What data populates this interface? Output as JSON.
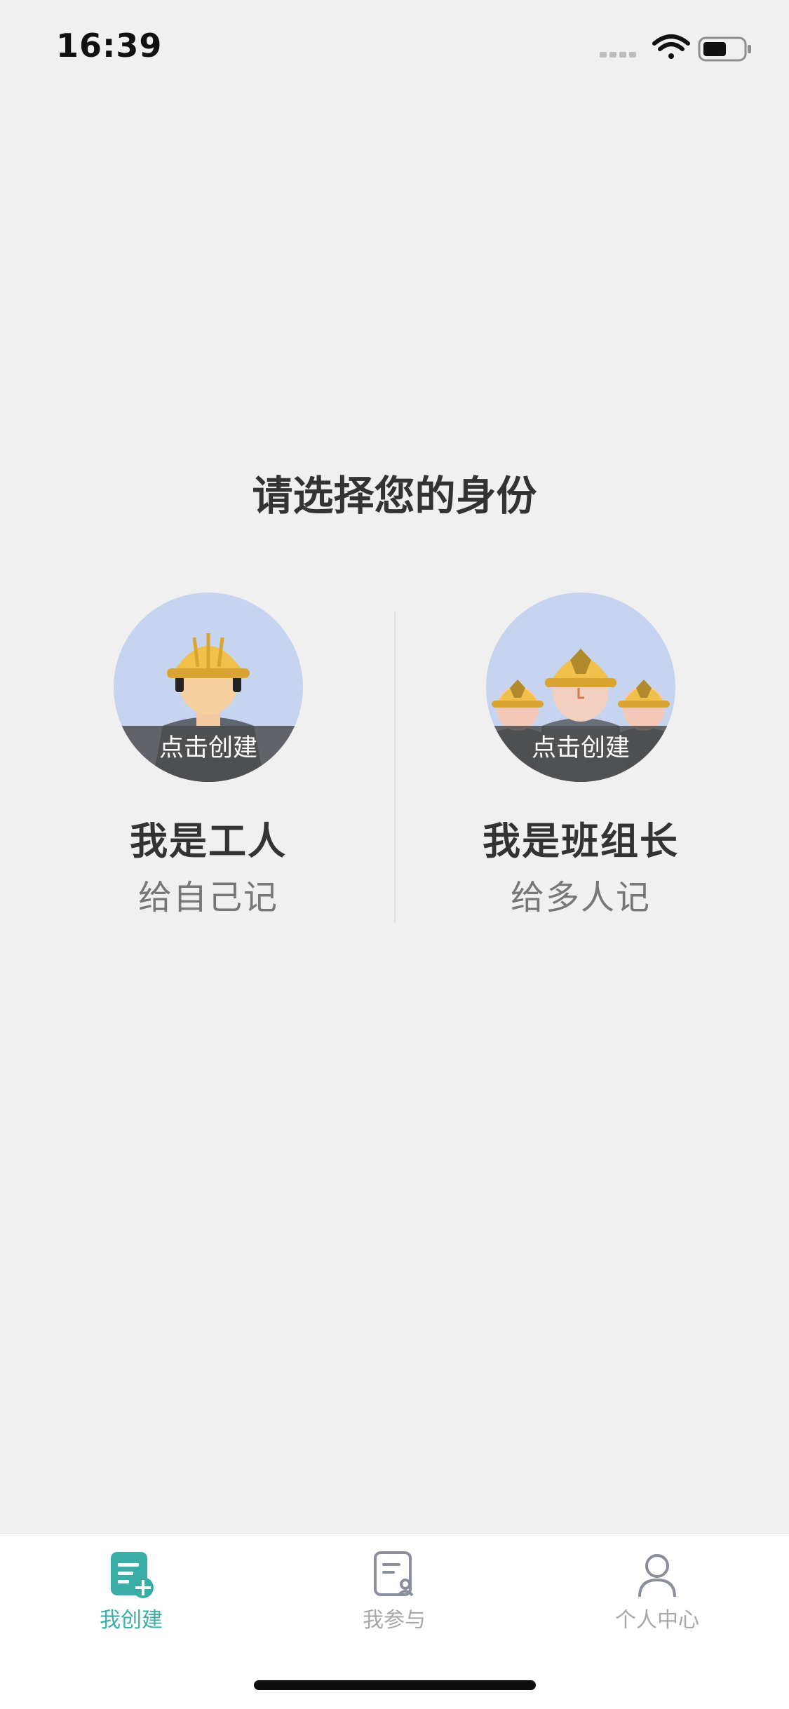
{
  "status_bar": {
    "time": "16:39",
    "icons": [
      "signal-icon",
      "wifi-icon",
      "battery-icon"
    ]
  },
  "title": "请选择您的身份",
  "options": [
    {
      "overlay": "点击创建",
      "title": "我是工人",
      "subtitle": "给自己记",
      "icon": "worker-avatar-icon"
    },
    {
      "overlay": "点击创建",
      "title": "我是班组长",
      "subtitle": "给多人记",
      "icon": "team-leader-avatar-icon"
    }
  ],
  "tabs": [
    {
      "label": "我创建",
      "icon": "create-record-icon",
      "active": true
    },
    {
      "label": "我参与",
      "icon": "participate-record-icon",
      "active": false
    },
    {
      "label": "个人中心",
      "icon": "user-profile-icon",
      "active": false
    }
  ],
  "colors": {
    "accent": "#3aaea6",
    "background": "#f0f0f0",
    "avatar_bg": "#c6d4ef",
    "helmet": "#f0c04a"
  }
}
